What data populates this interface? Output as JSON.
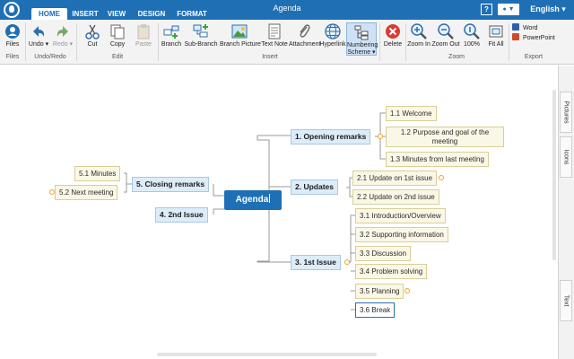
{
  "window": {
    "title": "Agenda",
    "language": "English",
    "help_label": "?",
    "user_label": "▼"
  },
  "ribbon_tabs": [
    {
      "label": "HOME",
      "active": true
    },
    {
      "label": "INSERT",
      "active": false
    },
    {
      "label": "VIEW",
      "active": false
    },
    {
      "label": "DESIGN",
      "active": false
    },
    {
      "label": "FORMAT",
      "active": false
    }
  ],
  "toolbar": {
    "files": {
      "label": "Files",
      "icon": "files-icon"
    },
    "undo": {
      "label": "Undo ▾",
      "icon": "undo-icon"
    },
    "redo": {
      "label": "Redo ▾",
      "icon": "redo-icon"
    },
    "cut": {
      "label": "Cut",
      "icon": "scissors-icon"
    },
    "copy": {
      "label": "Copy",
      "icon": "copy-icon"
    },
    "paste": {
      "label": "Paste",
      "icon": "paste-icon"
    },
    "branch": {
      "label": "Branch",
      "icon": "branch-icon"
    },
    "sub_branch": {
      "label": "Sub-Branch",
      "icon": "sub-branch-icon"
    },
    "branch_picture": {
      "label": "Branch Picture",
      "icon": "picture-icon"
    },
    "text_note": {
      "label": "Text Note",
      "icon": "note-icon"
    },
    "attachment": {
      "label": "Attachment",
      "icon": "paperclip-icon"
    },
    "hyperlink": {
      "label": "Hyperlink",
      "icon": "globe-icon"
    },
    "numbering": {
      "label": "Numbering Scheme ▾",
      "label_line1": "Numbering",
      "label_line2": "Scheme ▾",
      "icon": "numbering-icon"
    },
    "delete": {
      "label": "Delete",
      "icon": "delete-icon"
    },
    "zoom_in": {
      "label": "Zoom In",
      "icon": "zoom-in-icon"
    },
    "zoom_out": {
      "label": "Zoom Out",
      "icon": "zoom-out-icon"
    },
    "zoom_100": {
      "label": "100%",
      "icon": "zoom-100-icon"
    },
    "fit_all": {
      "label": "Fit All",
      "icon": "fit-all-icon"
    },
    "export_word": {
      "label": "Word",
      "icon": "word-icon"
    },
    "export_powerpoint": {
      "label": "PowerPoint",
      "icon": "powerpoint-icon"
    }
  },
  "ribbon_groups": {
    "files": "Files",
    "undo_redo": "Undo/Redo",
    "edit": "Edit",
    "insert": "Insert",
    "zoom": "Zoom",
    "export": "Export"
  },
  "colors": {
    "brand": "#1f6fb5",
    "main_topic_fill": "#dcecf8",
    "subtopic_fill": "#fbf7e6",
    "link_line": "#9a9a9a",
    "handle": "#e9a52a"
  },
  "mindmap": {
    "central": "Agenda",
    "topics": {
      "opening": "1. Opening remarks",
      "updates": "2. Updates",
      "first_issue": "3. 1st Issue",
      "second_issue": "4. 2nd Issue",
      "closing": "5. Closing remarks"
    },
    "subtopics": {
      "welcome": "1.1 Welcome",
      "purpose": "1.2 Purpose and goal of the meeting",
      "minutes_last": "1.3 Minutes from last meeting",
      "update_1": "2.1 Update on 1st issue",
      "update_2": "2.2 Update on 2nd issue",
      "intro": "3.1 Introduction/Overview",
      "supporting": "3.2 Supporting information",
      "discussion": "3.3 Discussion",
      "problem": "3.4 Problem solving",
      "planning": "3.5 Planning",
      "break": "3.6 Break",
      "minutes": "5.1 Minutes",
      "next_meeting": "5.2 Next meeting"
    }
  },
  "side_tabs": {
    "pictures": "Pictures",
    "icons": "Icons",
    "text": "Text"
  }
}
